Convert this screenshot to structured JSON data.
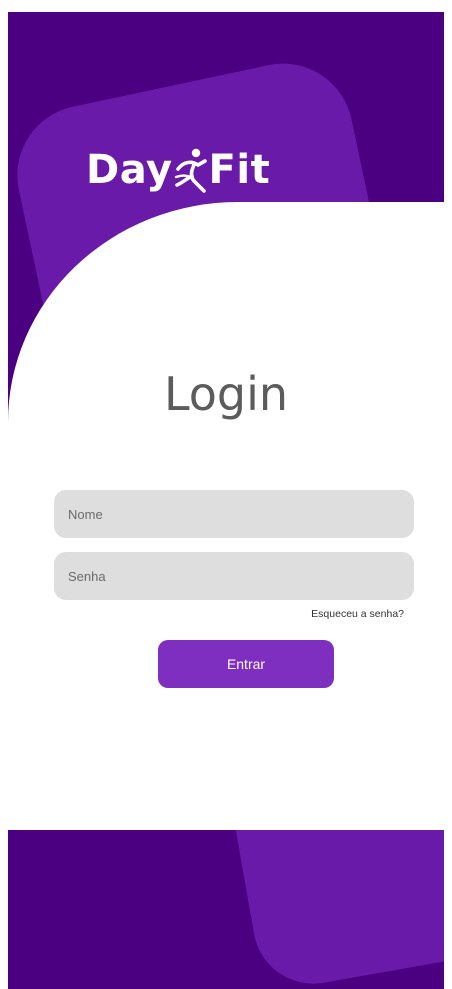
{
  "brand": {
    "name_left": "Day",
    "name_right": "Fit",
    "logo_icon": "runner-icon"
  },
  "login": {
    "title": "Login",
    "name_placeholder": "Nome",
    "password_placeholder": "Senha",
    "forgot_label": "Esqueceu a senha?",
    "submit_label": "Entrar"
  },
  "colors": {
    "background": "#4b0082",
    "accent_card": "#6a1aa8",
    "button": "#7f2fc0",
    "input_bg": "#dedede",
    "panel": "#ffffff"
  }
}
